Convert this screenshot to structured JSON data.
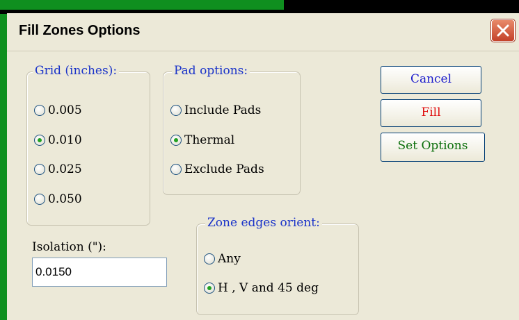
{
  "window": {
    "title": "Fill Zones Options"
  },
  "grid_group": {
    "legend": "Grid (inches):",
    "options": [
      {
        "label": "0.005",
        "selected": false
      },
      {
        "label": "0.010",
        "selected": true
      },
      {
        "label": "0.025",
        "selected": false
      },
      {
        "label": "0.050",
        "selected": false
      }
    ]
  },
  "pad_group": {
    "legend": "Pad options:",
    "options": [
      {
        "label": "Include Pads",
        "selected": false
      },
      {
        "label": "Thermal",
        "selected": true
      },
      {
        "label": "Exclude Pads",
        "selected": false
      }
    ]
  },
  "orient_group": {
    "legend": "Zone edges orient:",
    "options": [
      {
        "label": "Any",
        "selected": false
      },
      {
        "label": "H , V and 45 deg",
        "selected": true
      }
    ]
  },
  "isolation": {
    "label": "Isolation (\"):",
    "value": "0.0150"
  },
  "buttons": {
    "cancel": "Cancel",
    "fill": "Fill",
    "set_options": "Set Options"
  },
  "colors": {
    "legend_text": "#1a33c9",
    "cancel_text": "#1a1acc",
    "fill_text": "#e01010",
    "set_options_text": "#0a6e0a",
    "radio_dot": "#21a121"
  }
}
